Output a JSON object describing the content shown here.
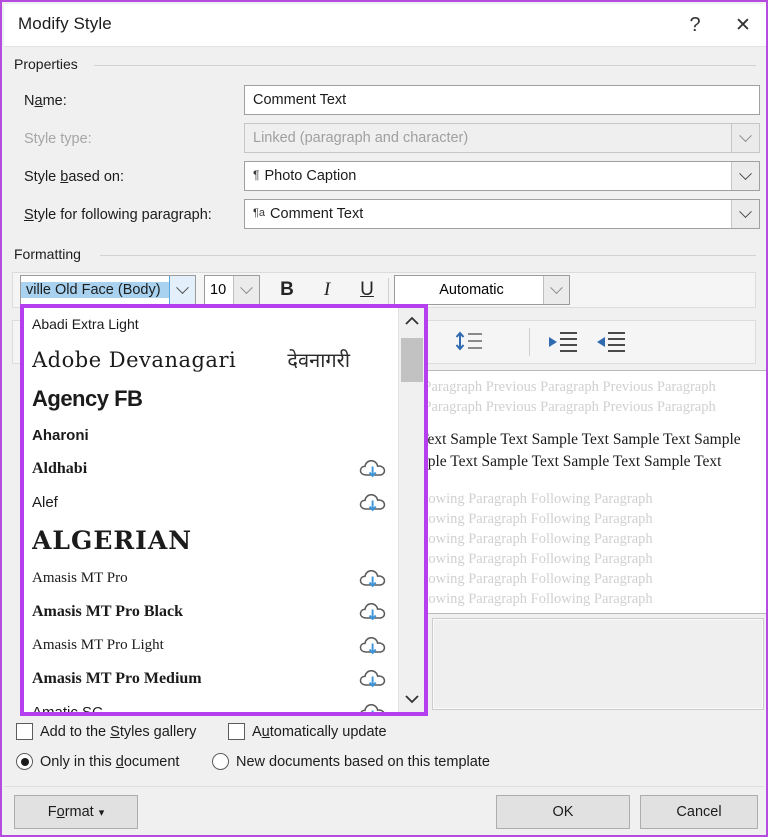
{
  "window": {
    "title": "Modify Style",
    "help_label": "?",
    "close_label": "✕"
  },
  "properties": {
    "section_label": "Properties",
    "rows": [
      {
        "label_pre": "N",
        "label_key": "a",
        "label_post": "me:",
        "value": "Comment Text",
        "type": "text",
        "disabled": false
      },
      {
        "label_pre": "Style type:",
        "label_key": "",
        "label_post": "",
        "value": "Linked (paragraph and character)",
        "type": "dropdown",
        "disabled": true
      },
      {
        "label_pre": "Style ",
        "label_key": "b",
        "label_post": "ased on:",
        "value": "Photo Caption",
        "icon": "¶",
        "type": "dropdown",
        "disabled": false
      },
      {
        "label_pre": "",
        "label_key": "S",
        "label_post": "tyle for following paragraph:",
        "value": "Comment Text",
        "icon": "¶a",
        "type": "dropdown",
        "disabled": false
      }
    ]
  },
  "formatting": {
    "section_label": "Formatting",
    "font_name": "ville Old Face (Body)",
    "font_size": "10",
    "bold_label": "B",
    "italic_label": "I",
    "underline_label": "U",
    "font_color": "Automatic"
  },
  "font_dropdown": {
    "items": [
      {
        "name": "Abadi Extra Light",
        "native": "",
        "cloud": false,
        "style": "sans-light",
        "size": 14
      },
      {
        "name": "Adobe Devanagari",
        "native": "देवनागरी",
        "cloud": false,
        "style": "serif-wide",
        "size": 21
      },
      {
        "name": "Agency FB",
        "native": "",
        "cloud": false,
        "style": "condensed",
        "size": 22
      },
      {
        "name": "Aharoni",
        "native": "",
        "cloud": false,
        "style": "bold-sans",
        "size": 15
      },
      {
        "name": "Aldhabi",
        "native": "",
        "cloud": true,
        "style": "bold-serif",
        "size": 16
      },
      {
        "name": "Alef",
        "native": "",
        "cloud": true,
        "style": "sans",
        "size": 15
      },
      {
        "name": "ALGERIAN",
        "native": "",
        "cloud": false,
        "style": "display",
        "size": 25
      },
      {
        "name": "Amasis MT Pro",
        "native": "",
        "cloud": true,
        "style": "serif",
        "size": 15
      },
      {
        "name": "Amasis MT Pro Black",
        "native": "",
        "cloud": true,
        "style": "bold-serif",
        "size": 16
      },
      {
        "name": "Amasis MT Pro Light",
        "native": "",
        "cloud": true,
        "style": "serif-light",
        "size": 15
      },
      {
        "name": "Amasis MT Pro Medium",
        "native": "",
        "cloud": true,
        "style": "bold-serif",
        "size": 16
      },
      {
        "name": "Amatic SC",
        "native": "",
        "cloud": true,
        "style": "sans",
        "size": 15
      }
    ],
    "scroll_up_label": "ⱏ",
    "scroll_down_label": "ⱟ",
    "highlight_color": "#b53ff0"
  },
  "paragraph_toolbar": {
    "line_spacing_label": "line-spacing-icon",
    "indent_decrease_label": "decrease-indent-icon",
    "indent_increase_label": "increase-indent-icon"
  },
  "preview": {
    "previous_paragraph": "Previous Paragraph Previous Paragraph Previous Paragraph Previous Paragraph Previous Paragraph Previous Paragraph",
    "sample_text": "Sample Text Sample Text Sample Text Sample Text Sample Text Sample Text Sample Text Sample Text Sample Text",
    "following_paragraph_line": "Following Paragraph Following Paragraph",
    "following_paragraph_lines": 7
  },
  "options": {
    "add_to_gallery": {
      "label_pre": "Add to the ",
      "label_key": "S",
      "label_post": "tyles gallery",
      "checked": false
    },
    "automatically_update": {
      "label_pre": "A",
      "label_key": "u",
      "label_post": "tomatically update",
      "checked": false
    },
    "only_this_document": {
      "label_pre": "Only in this ",
      "label_key": "d",
      "label_post": "ocument",
      "selected": true
    },
    "new_documents": {
      "label_pre": "New documents based on this template",
      "label_key": "",
      "label_post": "",
      "selected": false
    }
  },
  "buttons": {
    "format": {
      "pre": "F",
      "key": "o",
      "post": "rmat",
      "caret": "▾"
    },
    "ok": "OK",
    "cancel": "Cancel"
  }
}
